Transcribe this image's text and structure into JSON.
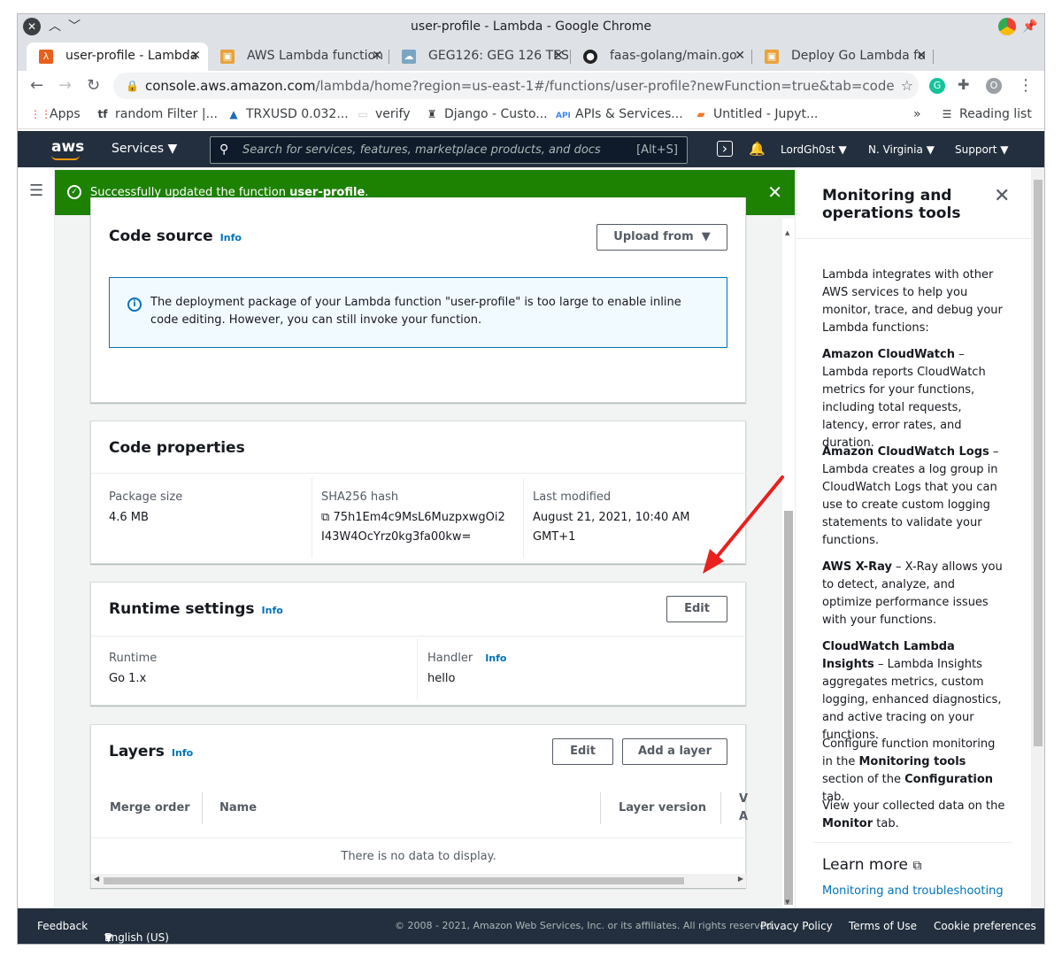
{
  "window": {
    "title": "user-profile - Lambda - Google Chrome"
  },
  "tabs": [
    {
      "label": "user-profile - Lambda",
      "active": true,
      "favicon": "lambda-icon",
      "color": "#e8601c"
    },
    {
      "label": "AWS Lambda function",
      "favicon": "aws-box-icon",
      "color": "#e9a23b"
    },
    {
      "label": "GEG126: GEG 126 TES",
      "favicon": "cloud-icon",
      "color": "#7aa6c2"
    },
    {
      "label": "faas-golang/main.go",
      "favicon": "github-icon",
      "color": "#202124"
    },
    {
      "label": "Deploy Go Lambda fu",
      "favicon": "aws-box-icon",
      "color": "#e9a23b"
    }
  ],
  "address": {
    "domain": "console.aws.amazon.com",
    "path": "/lambda/home?region=us-east-1#/functions/user-profile?newFunction=true&tab=code"
  },
  "bookmarks": [
    {
      "label": "Apps",
      "icon": "apps-grid-icon"
    },
    {
      "label": "random Filter |...",
      "icon": "tf-icon"
    },
    {
      "label": "TRXUSD 0.032...",
      "icon": "tron-icon"
    },
    {
      "label": "verify",
      "icon": "page-icon"
    },
    {
      "label": "Django - Custo...",
      "icon": "django-icon"
    },
    {
      "label": "APIs & Services...",
      "icon": "api-icon"
    },
    {
      "label": "Untitled - Jupyt...",
      "icon": "jupyter-icon"
    }
  ],
  "bookmarks_more": "»",
  "reading_list": "Reading list",
  "aws": {
    "logo": "aws",
    "services": "Services",
    "search_placeholder": "Search for services, features, marketplace products, and docs",
    "search_shortcut": "[Alt+S]",
    "user": "LordGh0st",
    "region": "N. Virginia",
    "support": "Support"
  },
  "banner": {
    "prefix": "Successfully updated the function ",
    "function_name": "user-profile",
    "suffix": "."
  },
  "code_source": {
    "title": "Code source",
    "info": "Info",
    "upload_button": "Upload from",
    "alert": "The deployment package of your Lambda function \"user-profile\" is too large to enable inline code editing. However, you can still invoke your function."
  },
  "code_properties": {
    "title": "Code properties",
    "package_size_label": "Package size",
    "package_size": "4.6 MB",
    "sha_label": "SHA256 hash",
    "sha_line1": "75h1Em4c9MsL6MuzpxwgOi2",
    "sha_line2": "I43W4OcYrz0kg3fa00kw=",
    "last_modified_label": "Last modified",
    "last_modified_line1": "August 21, 2021, 10:40 AM",
    "last_modified_line2": "GMT+1"
  },
  "runtime_settings": {
    "title": "Runtime settings",
    "info": "Info",
    "edit": "Edit",
    "runtime_label": "Runtime",
    "runtime": "Go 1.x",
    "handler_label": "Handler",
    "handler_info": "Info",
    "handler": "hello"
  },
  "layers": {
    "title": "Layers",
    "info": "Info",
    "edit": "Edit",
    "add": "Add a layer",
    "columns": [
      "Merge order",
      "Name",
      "Layer version",
      "V",
      "A"
    ],
    "empty": "There is no data to display."
  },
  "panel": {
    "title": "Monitoring and operations tools",
    "intro": "Lambda integrates with other AWS services to help you monitor, trace, and debug your Lambda functions:",
    "cw_title": "Amazon CloudWatch",
    "cw_text": " – Lambda reports CloudWatch metrics for your functions, including total requests, latency, error rates, and duration.",
    "cwl_title": "Amazon CloudWatch Logs",
    "cwl_text": " – Lambda creates a log group in CloudWatch Logs that you can use to create custom logging statements to validate your functions.",
    "xray_title": "AWS X-Ray",
    "xray_text": " – X-Ray allows you to detect, analyze, and optimize performance issues with your functions.",
    "insights_title": "CloudWatch Lambda Insights",
    "insights_text": " – Lambda Insights aggregates metrics, custom logging, enhanced diagnostics, and active tracing on your functions.",
    "configure_a": "Configure function monitoring in the ",
    "configure_b": "Monitoring tools",
    "configure_c": " section of the ",
    "configure_d": "Configuration",
    "configure_e": " tab.",
    "view_a": "View your collected data on the ",
    "view_b": "Monitor",
    "view_c": " tab.",
    "learn_more": "Learn more",
    "link": "Monitoring and troubleshooting"
  },
  "footer": {
    "feedback": "Feedback",
    "language": "English (US)",
    "copyright": "© 2008 - 2021, Amazon Web Services, Inc. or its affiliates. All rights reserved.",
    "privacy": "Privacy Policy",
    "terms": "Terms of Use",
    "cookies": "Cookie preferences"
  },
  "colors": {
    "success": "#1d8102",
    "aws_nav": "#232f3e",
    "link": "#0073bb",
    "arrow": "#e8201e"
  }
}
